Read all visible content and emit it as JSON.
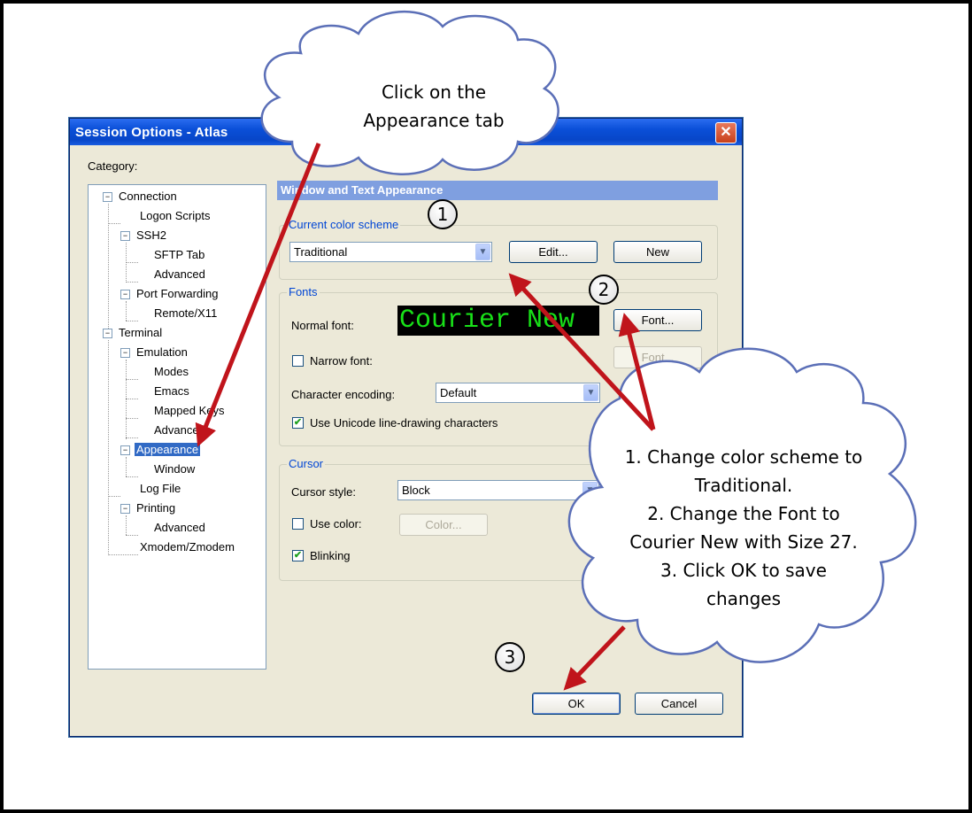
{
  "dialog": {
    "title": "Session Options - Atlas",
    "close_glyph": "✕",
    "category_label": "Category:",
    "tree": [
      {
        "label": "Connection",
        "expander": "−"
      },
      {
        "label": "Logon Scripts"
      },
      {
        "label": "SSH2",
        "expander": "−"
      },
      {
        "label": "SFTP Tab"
      },
      {
        "label": "Advanced"
      },
      {
        "label": "Port Forwarding",
        "expander": "−"
      },
      {
        "label": "Remote/X11"
      },
      {
        "label": "Terminal",
        "expander": "−"
      },
      {
        "label": "Emulation",
        "expander": "−"
      },
      {
        "label": "Modes"
      },
      {
        "label": "Emacs"
      },
      {
        "label": "Mapped Keys"
      },
      {
        "label": "Advanced"
      },
      {
        "label": "Appearance",
        "expander": "−",
        "selected": true
      },
      {
        "label": "Window"
      },
      {
        "label": "Log File"
      },
      {
        "label": "Printing",
        "expander": "−"
      },
      {
        "label": "Advanced"
      },
      {
        "label": "Xmodem/Zmodem"
      }
    ],
    "section_header": "Window and Text Appearance",
    "color_scheme": {
      "legend": "Current color scheme",
      "value": "Traditional",
      "edit_label": "Edit...",
      "new_label": "New"
    },
    "fonts": {
      "legend": "Fonts",
      "normal_font_label": "Normal font:",
      "preview_text": "Courier New",
      "font_button": "Font...",
      "narrow_font_label": "Narrow font:",
      "narrow_font_button": "Font...",
      "encoding_label": "Character encoding:",
      "encoding_value": "Default",
      "unicode_label": "Use Unicode line-drawing characters"
    },
    "cursor": {
      "legend": "Cursor",
      "style_label": "Cursor style:",
      "style_value": "Block",
      "use_color_label": "Use color:",
      "color_button": "Color...",
      "blinking_label": "Blinking"
    },
    "ok_label": "OK",
    "cancel_label": "Cancel"
  },
  "annotations": {
    "cloud_top_line1": "Click on the",
    "cloud_top_line2": "Appearance tab",
    "cloud_right_lines": [
      "1. Change color scheme to",
      "Traditional.",
      "2. Change the Font to",
      "Courier New with Size 27.",
      "3. Click OK to save",
      "changes"
    ],
    "step1": "1",
    "step2": "2",
    "step3": "3"
  },
  "colors": {
    "arrow": "#c0141b",
    "titlebar": "#0a4fd8",
    "selection": "#316ac5",
    "preview_text": "#18e018"
  }
}
